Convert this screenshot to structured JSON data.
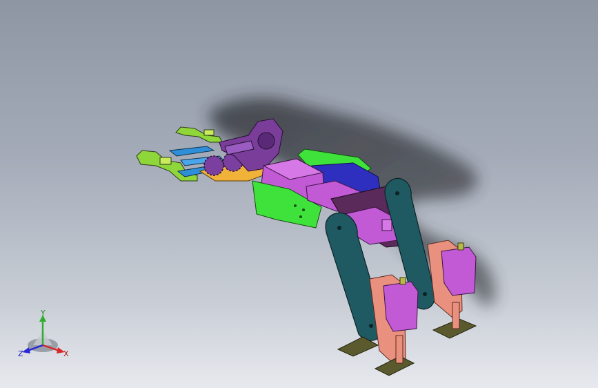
{
  "app": {
    "type": "3D CAD viewport",
    "background_colors": [
      "#8e96a4",
      "#e7e9ee"
    ]
  },
  "model": {
    "description_colors": {
      "gripper_fingers": "#8fd63a",
      "gripper_links": "#2e8fd8",
      "gears": "#7b3fa0",
      "gear_base": "#f1b23a",
      "green_bracket": "#3fe23a",
      "servo_body": "#c25ad6",
      "dark_servo_link": "#5a2a5a",
      "blue_bracket": "#2f2fbf",
      "legs": "#1f5a62",
      "salmon_brackets": "#e9907e",
      "feet": "#5a5a2e",
      "shadow": "#2e3034"
    }
  },
  "triad": {
    "x_label": "X",
    "y_label": "Y",
    "z_label": "Z",
    "x_color": "#d62828",
    "y_color": "#2fae2f",
    "z_color": "#2828d6"
  }
}
